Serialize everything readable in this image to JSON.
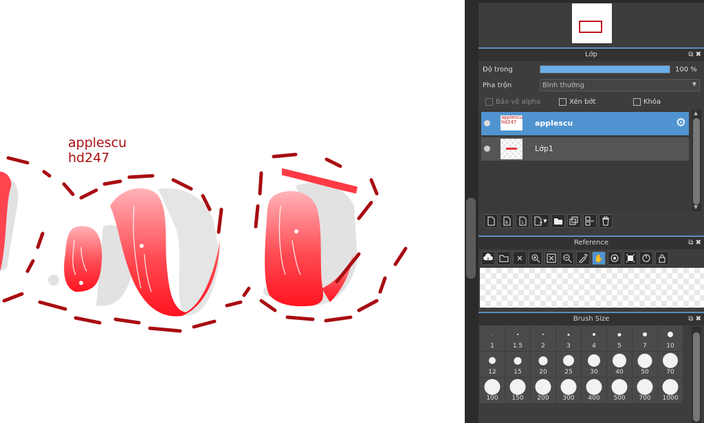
{
  "canvas": {
    "watermark_line1": "applescu",
    "watermark_line2": "hd247"
  },
  "layers_panel": {
    "title": "Lớp",
    "opacity_label": "Độ trong",
    "opacity_value": "100 %",
    "opacity_fraction": 1.0,
    "blend_label": "Pha trộn",
    "blend_value": "Bình thường",
    "protect_alpha_label": "Bảo vệ alpha",
    "clip_label": "Xén bớt",
    "lock_label": "Khóa",
    "layers": [
      {
        "name": "applescu",
        "thumb_text_1": "applescu",
        "thumb_text_2": "hd247",
        "selected": true
      },
      {
        "name": "Lớp1",
        "selected": false
      }
    ]
  },
  "reference_panel": {
    "title": "Reference"
  },
  "brush_panel": {
    "title": "Brush Size",
    "sizes": [
      "1",
      "1.5",
      "2",
      "3",
      "4",
      "5",
      "7",
      "10",
      "12",
      "15",
      "20",
      "25",
      "30",
      "40",
      "50",
      "70",
      "100",
      "150",
      "200",
      "300",
      "400",
      "500",
      "700",
      "1000"
    ]
  },
  "colors": {
    "accent": "#5b9bd5",
    "selected_layer": "#4f94d0",
    "ink": "#a80d12",
    "red": "#ff2a33"
  }
}
